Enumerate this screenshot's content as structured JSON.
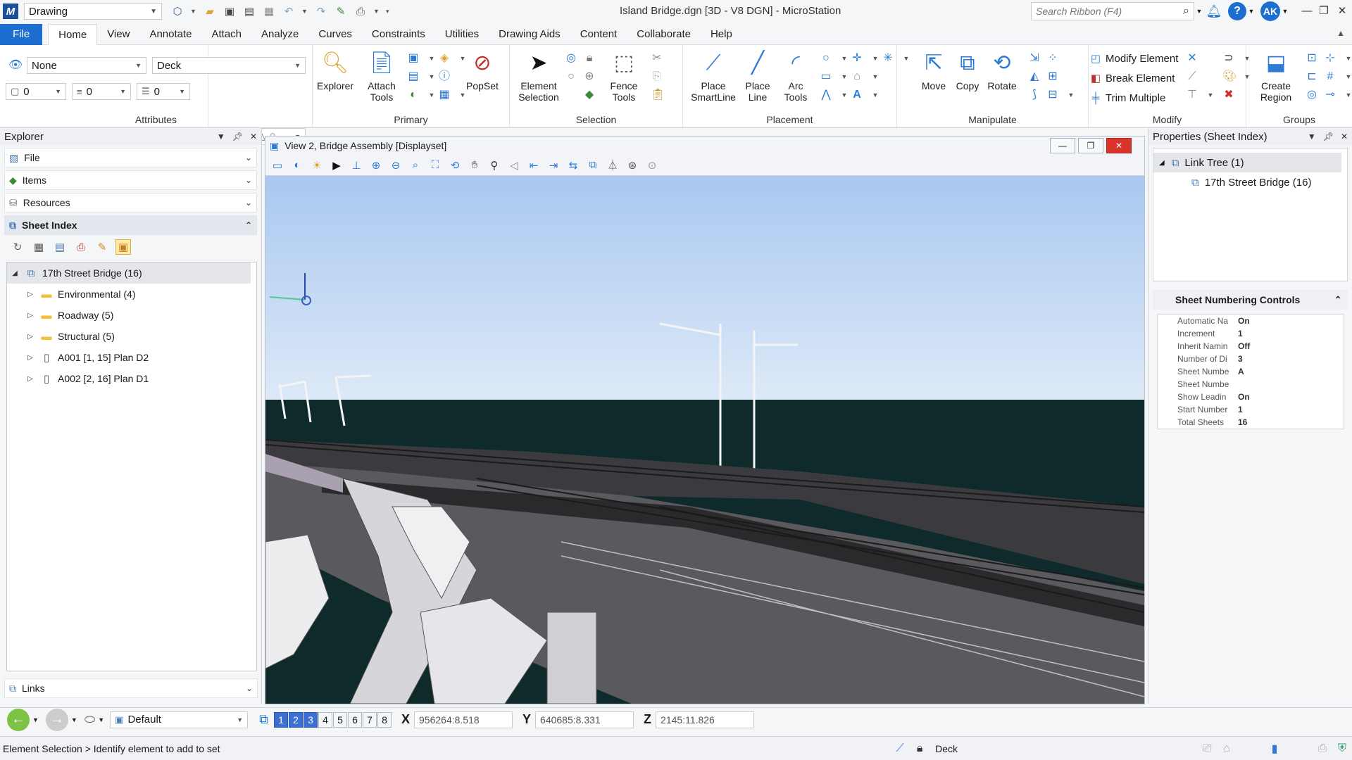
{
  "titlebar": {
    "workflow": "Drawing",
    "window_title": "Island Bridge.dgn [3D - V8 DGN] - MicroStation",
    "search_placeholder": "Search Ribbon (F4)",
    "avatar_initials": "AK"
  },
  "ribbon_tabs": [
    "File",
    "Home",
    "View",
    "Annotate",
    "Attach",
    "Analyze",
    "Curves",
    "Constraints",
    "Utilities",
    "Drawing Aids",
    "Content",
    "Collaborate",
    "Help"
  ],
  "ribbon": {
    "attributes": {
      "label": "Attributes",
      "level_none": "None",
      "level_deck": "Deck",
      "color_val": "0",
      "style_val": "0",
      "weight_val": "0",
      "transparency_val": "0",
      "priority_val": "0"
    },
    "primary": {
      "label": "Primary",
      "explorer": "Explorer",
      "attach_tools": "Attach Tools",
      "popset": "PopSet"
    },
    "selection": {
      "label": "Selection",
      "element_selection": "Element Selection",
      "fence_tools": "Fence Tools"
    },
    "placement": {
      "label": "Placement",
      "place_smartline": "Place SmartLine",
      "place_line": "Place Line",
      "arc_tools": "Arc Tools"
    },
    "manipulate": {
      "label": "Manipulate",
      "move": "Move",
      "copy": "Copy",
      "rotate": "Rotate"
    },
    "modify": {
      "label": "Modify",
      "modify_element": "Modify Element",
      "break_element": "Break Element",
      "trim_multiple": "Trim Multiple"
    },
    "groups": {
      "label": "Groups",
      "create_region": "Create Region"
    }
  },
  "explorer": {
    "title": "Explorer",
    "sections": [
      "File",
      "Items",
      "Resources",
      "Sheet Index"
    ],
    "links": "Links",
    "tree": [
      {
        "label": "17th Street Bridge (16)",
        "level": 0,
        "expanded": true,
        "icon": "sheet-index-icon"
      },
      {
        "label": "Environmental (4)",
        "level": 1,
        "icon": "folder-icon"
      },
      {
        "label": "Roadway (5)",
        "level": 1,
        "icon": "folder-icon"
      },
      {
        "label": "Structural (5)",
        "level": 1,
        "icon": "folder-icon"
      },
      {
        "label": "A001 [1, 15] Plan D2",
        "level": 1,
        "icon": "sheet-icon"
      },
      {
        "label": "A002 [2, 16] Plan D1",
        "level": 1,
        "icon": "sheet-icon"
      }
    ]
  },
  "view": {
    "title": "View 2, Bridge Assembly [Displayset]"
  },
  "properties": {
    "title": "Properties (Sheet Index)",
    "link_tree": "Link Tree (1)",
    "link_child": "17th Street Bridge (16)",
    "snc_title": "Sheet Numbering Controls",
    "snc_rows": [
      {
        "k": "Automatic Na",
        "v": "On"
      },
      {
        "k": "Increment",
        "v": "1"
      },
      {
        "k": "Inherit Namin",
        "v": "Off"
      },
      {
        "k": "Number of Di",
        "v": "3"
      },
      {
        "k": "Sheet Numbe",
        "v": "A"
      },
      {
        "k": "Sheet Numbe",
        "v": ""
      },
      {
        "k": "Show Leadin",
        "v": "On"
      },
      {
        "k": "Start Number",
        "v": "1"
      },
      {
        "k": "Total Sheets",
        "v": "16"
      }
    ]
  },
  "statusbar": {
    "view_group": "Default",
    "views": [
      "1",
      "2",
      "3",
      "4",
      "5",
      "6",
      "7",
      "8"
    ],
    "x_label": "X",
    "x_value": "956264:8.518",
    "y_label": "Y",
    "y_value": "640685:8.331",
    "z_label": "Z",
    "z_value": "2145:11.826",
    "message": "Element Selection > Identify element to add to set",
    "active_level": "Deck"
  },
  "colors": {
    "accent": "#1c6fd1",
    "sky": "#c8dcf2",
    "water": "#0f2a2a"
  }
}
